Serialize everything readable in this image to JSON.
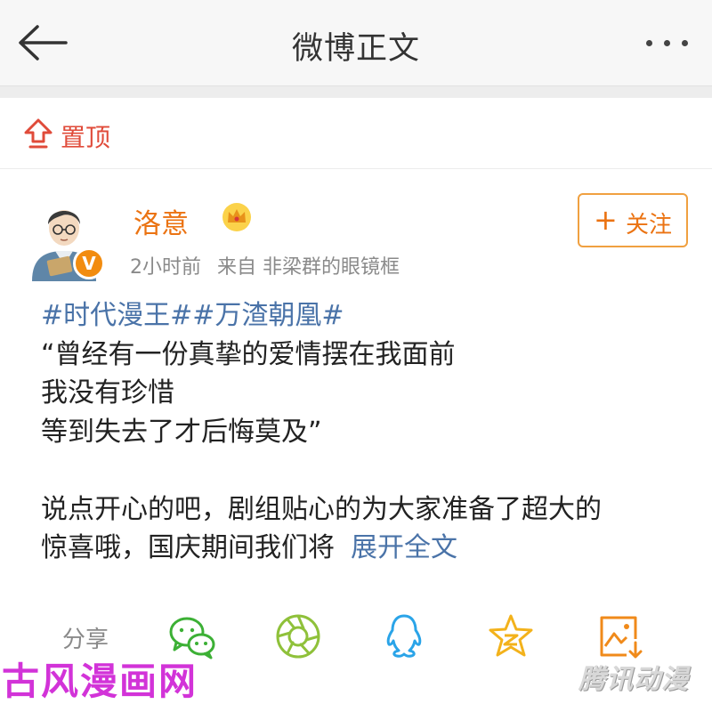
{
  "header": {
    "title": "微博正文",
    "back_icon": "arrow-left-icon",
    "more_icon": "more-dots-icon"
  },
  "pinned": {
    "label": "置顶",
    "icon": "pin-top-icon",
    "color": "#e04b3a"
  },
  "post": {
    "author": {
      "name": "洛意",
      "badge_icon": "crown-icon",
      "verified_letter": "V",
      "name_color": "#eb7312"
    },
    "time": "2小时前",
    "source_prefix": "来自",
    "source": "非梁群的眼镜框",
    "follow_label": "关注",
    "hashtags": "#时代漫王##万渣朝凰#",
    "lines": [
      "“曾经有一份真挚的爱情摆在我面前",
      "我没有珍惜",
      "等到失去了才后悔莫及”",
      "",
      "说点开心的吧，剧组贴心的为大家准备了超大的"
    ],
    "last_line": "惊喜哦，国庆期间我们将",
    "expand_label": "展开全文",
    "link_color": "#4a73a8"
  },
  "share": {
    "label": "分享",
    "icons": [
      "wechat-icon",
      "moments-icon",
      "qq-icon",
      "qzone-icon",
      "save-image-icon"
    ]
  },
  "watermarks": {
    "left": "古风漫画网",
    "right": "腾讯动漫"
  }
}
